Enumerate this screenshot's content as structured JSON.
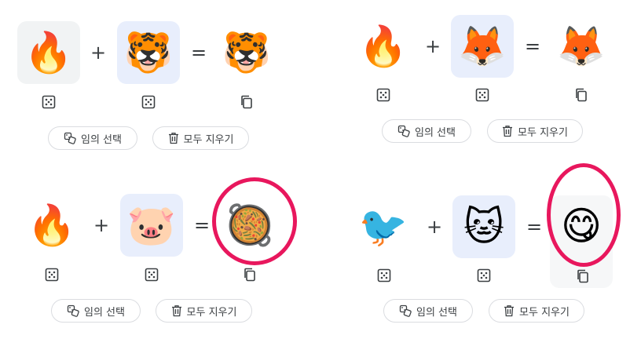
{
  "operators": {
    "plus": "+",
    "equals": "="
  },
  "buttons": {
    "random": "임의 선택",
    "clear": "모두 지우기"
  },
  "icons": {
    "dice": "dice-icon",
    "copy": "copy-icon",
    "random": "random-select-icon",
    "trash": "trash-icon"
  },
  "colors": {
    "highlight_ring": "#e8175d",
    "tile_grey": "#f1f3f4",
    "tile_blue": "#e8eefc"
  },
  "panels": [
    {
      "left": "🔥",
      "right": "🐯",
      "result": "🐯"
    },
    {
      "left": "🔥",
      "right": "🦊",
      "result": "🦊"
    },
    {
      "left": "🔥",
      "right": "🐷",
      "result": "🥘"
    },
    {
      "left": "🐦",
      "right": "🐱",
      "result": "😋"
    }
  ]
}
